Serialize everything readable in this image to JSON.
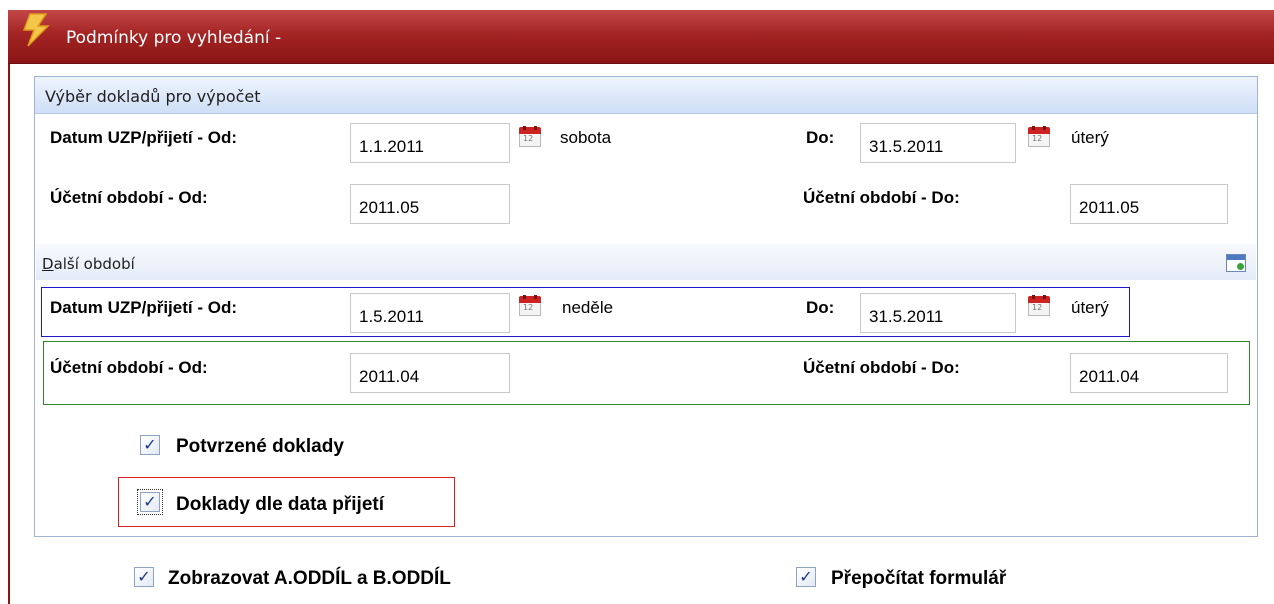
{
  "window": {
    "title": "Podmínky pro vyhledání -"
  },
  "panel": {
    "header": "Výběr dokladů pro výpočet"
  },
  "row1": {
    "from_label": "Datum UZP/přijetí - Od:",
    "from_value": "1.1.2011",
    "from_day": "sobota",
    "to_label": "Do:",
    "to_value": "31.5.2011",
    "to_day": "úterý"
  },
  "row2": {
    "from_label": "Účetní období - Od:",
    "from_value": "2011.05",
    "to_label": "Účetní období - Do:",
    "to_value": "2011.05"
  },
  "other_period": {
    "header_first_letter": "D",
    "header_rest": "alší období"
  },
  "row3": {
    "from_label": "Datum UZP/přijetí - Od:",
    "from_value": "1.5.2011",
    "from_day": "neděle",
    "to_label": "Do:",
    "to_value": "31.5.2011",
    "to_day": "úterý"
  },
  "row4": {
    "from_label": "Účetní období - Od:",
    "from_value": "2011.04",
    "to_label": "Účetní období - Do:",
    "to_value": "2011.04"
  },
  "checkboxes": {
    "confirmed": {
      "label": "Potvrzené doklady",
      "checked": true
    },
    "by_receipt": {
      "label": "Doklady dle data přijetí",
      "checked": true
    },
    "show_sections": {
      "label": "Zobrazovat A.ODDÍL a B.ODDÍL",
      "checked": true
    },
    "recalc": {
      "label": "Přepočítat formulář",
      "checked": true
    }
  },
  "check_glyph": "✓",
  "calendar_icon_text": "12",
  "colors": {
    "title_bar": "#a42424",
    "panel_border": "#9fb3d4",
    "highlight_blue": "#1a1acc",
    "highlight_green": "#2a8a2a",
    "highlight_red": "#e02020"
  }
}
